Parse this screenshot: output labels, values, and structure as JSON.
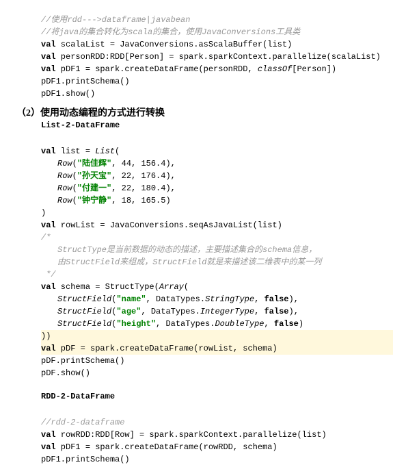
{
  "block1": {
    "c1": "//使用rdd--->dataframe|javabean",
    "c2": "//将java的集合转化为scala的集合，使用JavaConversions工具类",
    "l1a": "val",
    "l1b": " scalaList = JavaConversions.asScalaBuffer(list)",
    "l2a": "val",
    "l2b": " personRDD:RDD[Person] = spark.sparkContext.parallelize(scalaList)",
    "l3a": "val",
    "l3b": " pDF1 = spark.createDataFrame(personRDD, ",
    "l3c": "classOf",
    "l3d": "[Person])",
    "l4": "pDF1.printSchema()",
    "l5": "pDF1.show()"
  },
  "heading": "（2）使用动态编程的方式进行转换",
  "sub1": "List-2-DataFrame",
  "block2": {
    "l1a": "val",
    "l1b": " list = ",
    "l1c": "List",
    "l1d": "(",
    "rows": [
      {
        "name": "\"陆佳辉\"",
        "a": "44",
        "b": "156.4"
      },
      {
        "name": "\"孙天宝\"",
        "a": "22",
        "b": "176.4"
      },
      {
        "name": "\"付建一\"",
        "a": "22",
        "b": "180.4"
      },
      {
        "name": "\"钟宁静\"",
        "a": "18",
        "b": "165.5"
      }
    ],
    "close1": ")",
    "l2a": "val",
    "l2b": " rowList = JavaConversions.seqAsJavaList(list)",
    "c_open": "/*",
    "c_l1": "StructType是当前数据的动态的描述，主要描述集合的schema信息，",
    "c_l2": "由StructField来组成，StructField就是来描述该二维表中的某一列",
    "c_close": " */",
    "l3a": "val",
    "l3b": " schema = StructType(",
    "l3c": "Array",
    "l3d": "(",
    "sf": [
      {
        "name": "\"name\"",
        "dt": "StringType"
      },
      {
        "name": "\"age\"",
        "dt": "IntegerType"
      },
      {
        "name": "\"height\"",
        "dt": "DoubleType"
      }
    ],
    "false": "false",
    "close2": "))",
    "l4a": "val",
    "l4b": " pDF = spark.createDataFrame(rowList, schema)",
    "l5": "pDF.printSchema()",
    "l6": "pDF.show()"
  },
  "sub2": "RDD-2-DataFrame",
  "block3": {
    "c1": "//rdd-2-dataframe",
    "l1a": "val",
    "l1b": " rowRDD:RDD[Row] = spark.sparkContext.parallelize(list)",
    "l2a": "val",
    "l2b": " pDF1 = spark.createDataFrame(rowRDD, schema)",
    "l3": "pDF1.printSchema()"
  },
  "rowPrefix": "Row",
  "structField": "StructField",
  "dataTypes": "DataTypes"
}
